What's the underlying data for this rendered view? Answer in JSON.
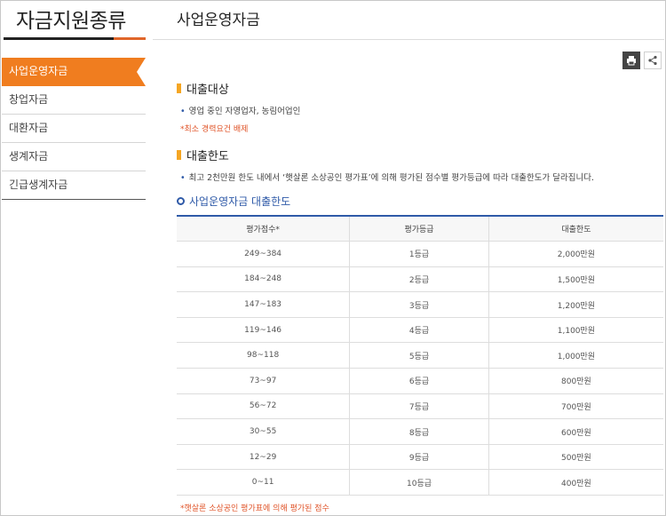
{
  "sidebar": {
    "title": "자금지원종류",
    "items": [
      {
        "label": "사업운영자금",
        "active": true
      },
      {
        "label": "창업자금",
        "active": false
      },
      {
        "label": "대환자금",
        "active": false
      },
      {
        "label": "생계자금",
        "active": false
      },
      {
        "label": "긴급생계자금",
        "active": false
      }
    ]
  },
  "main": {
    "title": "사업운영자금",
    "tools": {
      "print_icon": "print-icon",
      "share_icon": "share-icon"
    },
    "target": {
      "heading": "대출대상",
      "bullet": "영업 중인 자영업자, 농림어업인",
      "note": "*최소 경력요건 배제"
    },
    "limit": {
      "heading": "대출한도",
      "bullet": "최고 2천만원 한도 내에서 ‘햇살론 소상공인 평가표’에 의해 평가된 점수별 평가등급에 따라 대출한도가 달라집니다."
    },
    "table_title": "사업운영자금 대출한도",
    "table": {
      "headers": [
        "평가점수*",
        "평가등급",
        "대출한도"
      ],
      "rows": [
        [
          "249~384",
          "1등급",
          "2,000만원"
        ],
        [
          "184~248",
          "2등급",
          "1,500만원"
        ],
        [
          "147~183",
          "3등급",
          "1,200만원"
        ],
        [
          "119~146",
          "4등급",
          "1,100만원"
        ],
        [
          "98~118",
          "5등급",
          "1,000만원"
        ],
        [
          "73~97",
          "6등급",
          "800만원"
        ],
        [
          "56~72",
          "7등급",
          "700만원"
        ],
        [
          "30~55",
          "8등급",
          "600만원"
        ],
        [
          "12~29",
          "9등급",
          "500만원"
        ],
        [
          "0~11",
          "10등급",
          "400만원"
        ]
      ]
    },
    "footnote": "*햇살론 소상공인 평가표에 의해 평가된 점수"
  },
  "colors": {
    "accent": "#f07d1f",
    "blue": "#2f5aa8",
    "note": "#e0552a",
    "marker": "#f5a623"
  }
}
